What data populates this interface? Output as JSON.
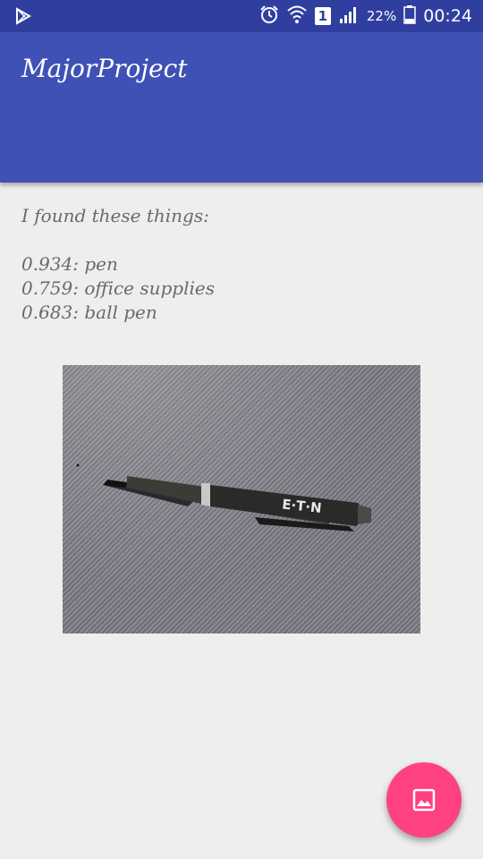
{
  "status_bar": {
    "battery_text": "22%",
    "time": "00:24",
    "sim_label": "1",
    "icons": [
      "play-store-icon",
      "alarm-icon",
      "wifi-icon",
      "signal-icon",
      "battery-icon"
    ]
  },
  "toolbar": {
    "title": "MajorProject"
  },
  "main": {
    "heading": "I found these things:",
    "results": [
      "0.934: pen",
      "0.759: office supplies",
      "0.683: ball pen"
    ],
    "photo_pen_text": "E·T·N"
  },
  "fab": {
    "icon": "image-icon"
  },
  "colors": {
    "status_bar": "#303f9f",
    "toolbar": "#3f51b5",
    "background": "#eeeeee",
    "fab": "#ff4081",
    "text": "#6a6a6a"
  }
}
